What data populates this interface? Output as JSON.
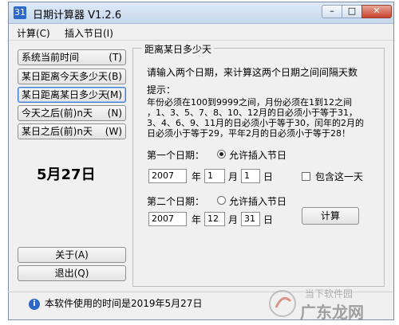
{
  "window": {
    "title": "日期计算器 V1.2.6",
    "app_icon": "31"
  },
  "titlebar_buttons": {
    "minimize_glyph": "–",
    "maximize_glyph": "□",
    "close_glyph": "✕"
  },
  "menu": {
    "items": [
      "计算(C)",
      "插入节日(I)"
    ]
  },
  "sidebar": {
    "items": [
      {
        "label": "系统当前时间",
        "key": "(T)"
      },
      {
        "label": "某日距离今天多少天",
        "key": "(B)"
      },
      {
        "label": "某日距离某日多少天",
        "key": "(M)"
      },
      {
        "label": "今天之后(前)n天",
        "key": "(N)"
      },
      {
        "label": "某日之后(前)n天",
        "key": "(W)"
      }
    ],
    "active_index": 2,
    "current_date": "5月27日",
    "about_button": "关于(A)",
    "exit_button": "退出(Q)"
  },
  "main": {
    "group_title": "距离某日多少天",
    "instruction": "请输入两个日期，来计算这两个日期之间间隔天数",
    "tip_title": "提示：",
    "tip_lines": [
      "年份必须在100到9999之间，月份必须在1到12之间",
      "，1、3、5、7、8、10、12月的日必须小于等于31，",
      "3、4、6、9、11月的日必须小于等于30，闰年的2月的",
      "日必须小于等于29，平年2月的日必须小于等于28！"
    ],
    "first_date": {
      "label": "第一个日期：",
      "insert_holiday_label": "允许插入节日",
      "insert_holiday_selected": true,
      "year": "2007",
      "year_unit": "年",
      "month": "1",
      "month_unit": "月",
      "day": "1",
      "day_unit": "日"
    },
    "include_day": {
      "label": "包含这一天",
      "checked": false
    },
    "second_date": {
      "label": "第二个日期：",
      "insert_holiday_label": "允许插入节日",
      "insert_holiday_selected": false,
      "year": "2007",
      "year_unit": "年",
      "month": "12",
      "month_unit": "月",
      "day": "31",
      "day_unit": "日"
    },
    "calculate_button": "计算"
  },
  "status": {
    "icon": "info-icon",
    "text": "本软件使用的时间是2019年5月27日"
  },
  "watermark": {
    "line1": "当下软件园",
    "line2": "广东龙网"
  }
}
